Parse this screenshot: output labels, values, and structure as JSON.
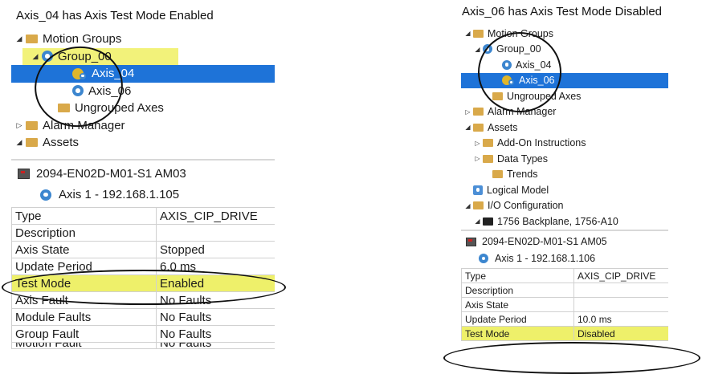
{
  "captions": {
    "left": "Axis_04 has Axis Test Mode Enabled",
    "right": "Axis_06 has Axis Test Mode Disabled"
  },
  "left_tree": [
    {
      "label": "Motion Groups",
      "icon": "folder-icon",
      "arrow": "◢"
    },
    {
      "label": "Group_00",
      "icon": "motion-group-icon",
      "arrow": "◢"
    },
    {
      "label": "Axis_04",
      "icon": "axis-test-mode-icon",
      "arrow": ""
    },
    {
      "label": "Axis_06",
      "icon": "axis-icon",
      "arrow": ""
    },
    {
      "label": "Ungrouped Axes",
      "icon": "folder-icon",
      "arrow": ""
    },
    {
      "label": "Alarm Manager",
      "icon": "folder-icon",
      "arrow": "▷"
    },
    {
      "label": "Assets",
      "icon": "folder-icon",
      "arrow": "◢"
    }
  ],
  "left_details": {
    "device": "2094-EN02D-M01-S1  AM03",
    "axis": "Axis 1 - 192.168.1.105",
    "properties": [
      {
        "name": "Type",
        "value": "AXIS_CIP_DRIVE"
      },
      {
        "name": "Description",
        "value": ""
      },
      {
        "name": "Axis State",
        "value": "Stopped"
      },
      {
        "name": "Update Period",
        "value": "6.0 ms"
      },
      {
        "name": "Test Mode",
        "value": "Enabled"
      },
      {
        "name": "Axis Fault",
        "value": "No Faults"
      },
      {
        "name": "Module Faults",
        "value": "No Faults"
      },
      {
        "name": "Group Fault",
        "value": "No Faults"
      },
      {
        "name": "Motion Fault",
        "value": "No Faults"
      }
    ]
  },
  "right_tree": [
    {
      "label": "Motion Groups",
      "icon": "folder-icon",
      "arrow": "◢"
    },
    {
      "label": "Group_00",
      "icon": "motion-group-icon",
      "arrow": "◢"
    },
    {
      "label": "Axis_04",
      "icon": "axis-icon",
      "arrow": ""
    },
    {
      "label": "Axis_06",
      "icon": "axis-test-mode-icon",
      "arrow": ""
    },
    {
      "label": "Ungrouped Axes",
      "icon": "folder-icon",
      "arrow": ""
    },
    {
      "label": "Alarm Manager",
      "icon": "folder-icon",
      "arrow": "▷"
    },
    {
      "label": "Assets",
      "icon": "folder-icon",
      "arrow": "◢"
    },
    {
      "label": "Add-On Instructions",
      "icon": "folder-icon",
      "arrow": "▷"
    },
    {
      "label": "Data Types",
      "icon": "folder-icon",
      "arrow": "▷"
    },
    {
      "label": "Trends",
      "icon": "folder-icon",
      "arrow": ""
    },
    {
      "label": "Logical Model",
      "icon": "logical-model-icon",
      "arrow": ""
    },
    {
      "label": "I/O Configuration",
      "icon": "folder-icon",
      "arrow": "◢"
    },
    {
      "label": "1756 Backplane, 1756-A10",
      "icon": "backplane-icon",
      "arrow": "◢"
    }
  ],
  "right_details": {
    "device": "2094-EN02D-M01-S1  AM05",
    "axis": "Axis 1 - 192.168.1.106",
    "properties": [
      {
        "name": "Type",
        "value": "AXIS_CIP_DRIVE"
      },
      {
        "name": "Description",
        "value": ""
      },
      {
        "name": "Axis State",
        "value": ""
      },
      {
        "name": "Update Period",
        "value": "10.0 ms"
      },
      {
        "name": "Test Mode",
        "value": "Disabled"
      }
    ]
  },
  "colors": {
    "selection": "#1e73d8",
    "highlight": "#eef06a",
    "folder": "#d9a94a",
    "axis_icon": "#3c86cf",
    "test_mode_icon": "#e0b62a"
  }
}
